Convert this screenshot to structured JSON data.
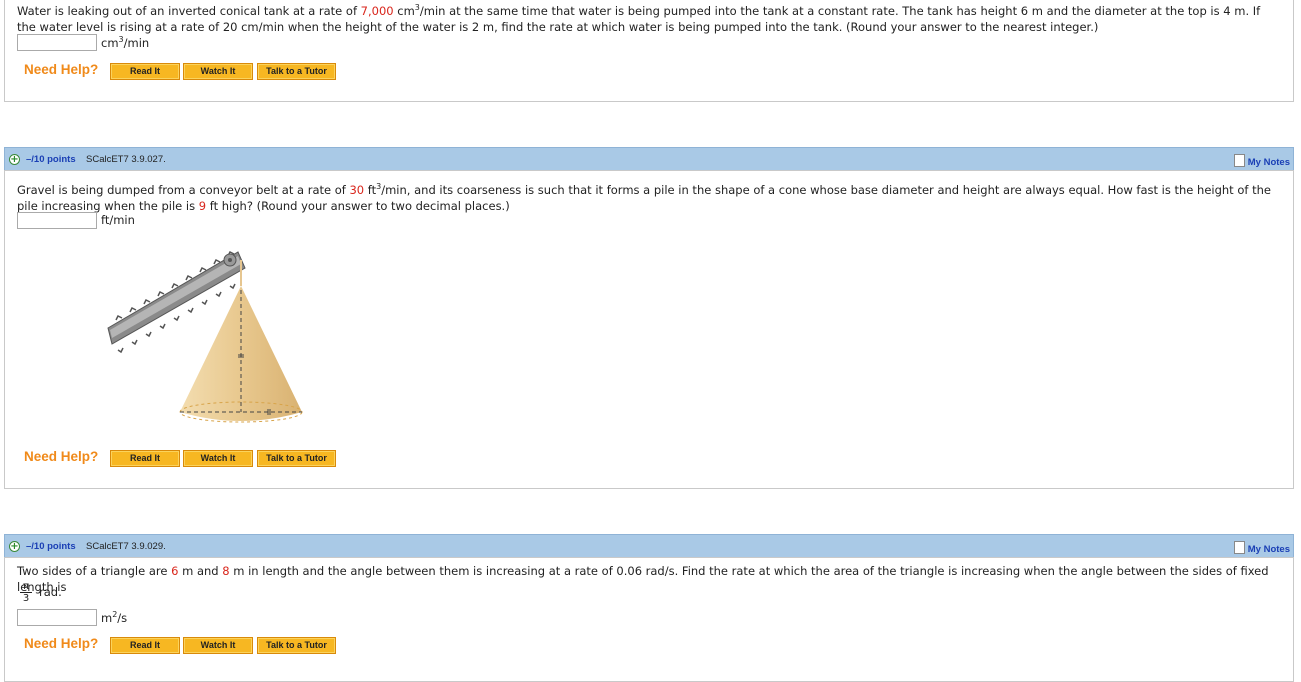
{
  "q1": {
    "text_parts": [
      "Water is leaking out of an inverted conical tank at a rate of ",
      "7,000",
      " cm",
      "3",
      "/min at the same time that water is being pumped into the tank at a constant rate. The tank has height 6 m and the diameter at the top is 4 m. If the water level is rising at a rate of 20 cm/min when the height of the water is 2 m, find the rate at which water is being pumped into the tank. (Round your answer to the nearest integer.)"
    ],
    "unit_base": "cm",
    "unit_sup": "3",
    "unit_tail": "/min"
  },
  "q2": {
    "points": "–/10 points",
    "code": "SCalcET7 3.9.027.",
    "text_parts": [
      "Gravel is being dumped from a conveyor belt at a rate of ",
      "30",
      " ft",
      "3",
      "/min, and its coarseness is such that it forms a pile in the shape of a cone whose base diameter and height are always equal. How fast is the height of the pile increasing when the pile is ",
      "9",
      " ft high? (Round your answer to two decimal places.)"
    ],
    "unit": "ft/min"
  },
  "q3": {
    "points": "–/10 points",
    "code": "SCalcET7 3.9.029.",
    "text_parts": [
      "Two sides of a triangle are ",
      "6",
      " m and ",
      "8",
      " m in length and the angle between them is increasing at a rate of 0.06 rad/s. Find the rate at which the area of the triangle is increasing when the angle between the sides of fixed length is"
    ],
    "frac_num": "π",
    "frac_den": "3",
    "frac_tail": "rad.",
    "unit_base": "m",
    "unit_sup": "2",
    "unit_tail": "/s"
  },
  "common": {
    "need_help": "Need Help?",
    "read_it": "Read It",
    "watch_it": "Watch It",
    "talk_tutor": "Talk to a Tutor",
    "my_notes": "My Notes",
    "plus": "+"
  },
  "colors": {
    "highlight": "#d9261c",
    "header_bg": "#a9c9e6",
    "help": "#f08a1a",
    "button": "#f7b722",
    "link": "#1a3fb5"
  }
}
